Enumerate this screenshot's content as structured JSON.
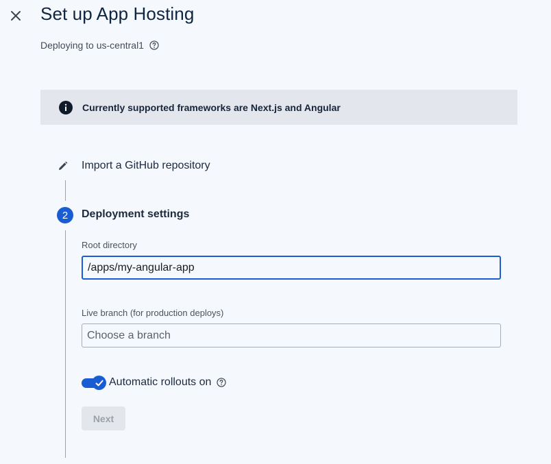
{
  "header": {
    "title": "Set up App Hosting",
    "subtitle": "Deploying to us-central1"
  },
  "banner": {
    "text": "Currently supported frameworks are Next.js and Angular"
  },
  "steps": {
    "step1": {
      "label": "Import a GitHub repository",
      "icon": "pencil-icon"
    },
    "step2": {
      "number": "2",
      "label": "Deployment settings"
    }
  },
  "form": {
    "root_directory": {
      "label": "Root directory",
      "value": "/apps/my-angular-app"
    },
    "live_branch": {
      "label": "Live branch (for production deploys)",
      "placeholder": "Choose a branch"
    },
    "auto_rollouts": {
      "label": "Automatic rollouts on",
      "enabled": true
    },
    "next_label": "Next"
  },
  "icons": {
    "close": "close-icon",
    "help": "help-circle-icon",
    "info": "info-icon",
    "check": "check-icon"
  },
  "colors": {
    "accent": "#1a5cd1",
    "background": "#f5f8fc",
    "banner": "#e3e7ed",
    "title": "#0f2540"
  }
}
